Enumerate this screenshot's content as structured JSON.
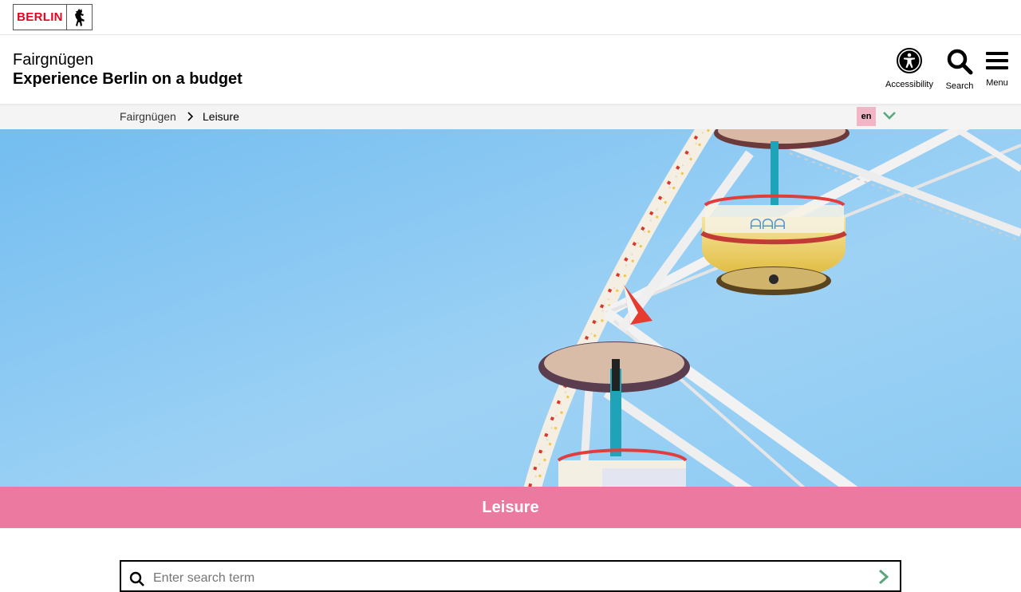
{
  "logo": {
    "text": "BERLIN",
    "icon": "berlin-bear-icon"
  },
  "header": {
    "title": "Fairgnügen",
    "subtitle": "Experience Berlin on a budget",
    "accessibility_label": "Accessibility",
    "search_label": "Search",
    "menu_label": "Menu"
  },
  "breadcrumb": {
    "home": "Fairgnügen",
    "current": "Leisure"
  },
  "language": {
    "current": "en"
  },
  "hero": {
    "subject": "ferris-wheel-photo"
  },
  "banner": {
    "title": "Leisure"
  },
  "search": {
    "placeholder": "Enter search term"
  },
  "colors": {
    "brand_red": "#e40422",
    "banner_pink": "#ec7aa0",
    "lang_pink": "#f2b5c6",
    "accent_green": "#5aa67c",
    "sky": "#8cc8f0"
  }
}
